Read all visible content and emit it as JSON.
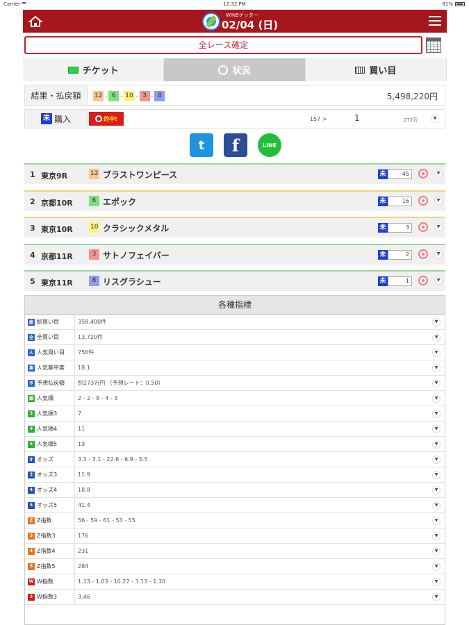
{
  "status_bar": {
    "carrier": "Carrier",
    "time": "12:32 PM",
    "battery": "81%"
  },
  "header": {
    "subtitle": "WIN5ゲッター",
    "date": "02/04 (日)"
  },
  "confirm_label": "全レース確定",
  "tabs": [
    {
      "label": "チケット"
    },
    {
      "label": "状況"
    },
    {
      "label": "買い目"
    }
  ],
  "result": {
    "label": "結果・払戻額",
    "numbers": [
      {
        "n": "12",
        "color": "#f7c795"
      },
      {
        "n": "6",
        "color": "#7ee07e"
      },
      {
        "n": "10",
        "color": "#fff27a"
      },
      {
        "n": "3",
        "color": "#f39292"
      },
      {
        "n": "8",
        "color": "#8e9bf0"
      }
    ],
    "payout": "5,498,220円"
  },
  "purchase": {
    "badge": "未",
    "label": "購入",
    "hit": "的中!",
    "info": "157 >",
    "count": "1",
    "amount": "272万"
  },
  "share": {
    "twitter": "t",
    "facebook": "f",
    "line": "LINE"
  },
  "races": [
    {
      "no": "1",
      "venue": "東京9R",
      "horse_no": "12",
      "horse_color": "#f7c795",
      "horse": "ブラストワンピース",
      "badge": "未",
      "count": "45",
      "accent": "#9bd39b"
    },
    {
      "no": "2",
      "venue": "京都10R",
      "horse_no": "6",
      "horse_color": "#7ee07e",
      "horse": "エポック",
      "badge": "未",
      "count": "16",
      "accent": "#f2d27a"
    },
    {
      "no": "3",
      "venue": "東京10R",
      "horse_no": "10",
      "horse_color": "#fff27a",
      "horse": "クラシックメタル",
      "badge": "未",
      "count": "3",
      "accent": "#f2d27a"
    },
    {
      "no": "4",
      "venue": "京都11R",
      "horse_no": "3",
      "horse_color": "#f39292",
      "horse": "サトノフェイバー",
      "badge": "未",
      "count": "2",
      "accent": "#9bd39b"
    },
    {
      "no": "5",
      "venue": "東京11R",
      "horse_no": "8",
      "horse_color": "#8e9bf0",
      "horse": "リスグラシュー",
      "badge": "未",
      "count": "1",
      "accent": "#9bd39b"
    }
  ],
  "metrics": {
    "title": "各種指標",
    "rows": [
      {
        "label": "総買い目",
        "value": "358,400件",
        "icon": "#2a64d0",
        "glyph": "総"
      },
      {
        "label": "全買い目",
        "value": "13,720件",
        "icon": "#2a64d0",
        "glyph": "全"
      },
      {
        "label": "人気買い目",
        "value": "756件",
        "icon": "#2a64d0",
        "glyph": "人"
      },
      {
        "label": "人気集中度",
        "value": "18.1",
        "icon": "#2a64d0",
        "glyph": "集"
      },
      {
        "label": "予想払戻額",
        "value": "約273万円 （予想レート：0.50）",
        "icon": "#2a64d0",
        "glyph": "予"
      },
      {
        "label": "人気順",
        "value": "2 - 2 - 8 - 4 - 3",
        "icon": "#2fb03a",
        "glyph": "順"
      },
      {
        "label": "人気順3",
        "value": "7",
        "icon": "#2fb03a",
        "glyph": "3"
      },
      {
        "label": "人気順4",
        "value": "11",
        "icon": "#2fb03a",
        "glyph": "4"
      },
      {
        "label": "人気順5",
        "value": "19",
        "icon": "#2fb03a",
        "glyph": "5"
      },
      {
        "label": "オッズ",
        "value": "3.3 - 3.1 - 22.6 - 6.9 - 5.5",
        "icon": "#2a4fc0",
        "glyph": "オ"
      },
      {
        "label": "オッズ3",
        "value": "11.9",
        "icon": "#2a4fc0",
        "glyph": "3"
      },
      {
        "label": "オッズ4",
        "value": "18.8",
        "icon": "#2a4fc0",
        "glyph": "4"
      },
      {
        "label": "オッズ5",
        "value": "41.4",
        "icon": "#2a4fc0",
        "glyph": "5"
      },
      {
        "label": "Z指数",
        "value": "56 - 59 - 61 - 53 - 55",
        "icon": "#e8751a",
        "glyph": "Z"
      },
      {
        "label": "Z指数3",
        "value": "176",
        "icon": "#e8751a",
        "glyph": "3"
      },
      {
        "label": "Z指数4",
        "value": "231",
        "icon": "#e8751a",
        "glyph": "4"
      },
      {
        "label": "Z指数5",
        "value": "284",
        "icon": "#e8751a",
        "glyph": "5"
      },
      {
        "label": "W指数",
        "value": "1.13 - 1.03 - 10.27 - 3.13 - 1.30",
        "icon": "#d01c1c",
        "glyph": "W"
      },
      {
        "label": "W指数3",
        "value": "3.46",
        "icon": "#d01c1c",
        "glyph": "3"
      }
    ]
  }
}
